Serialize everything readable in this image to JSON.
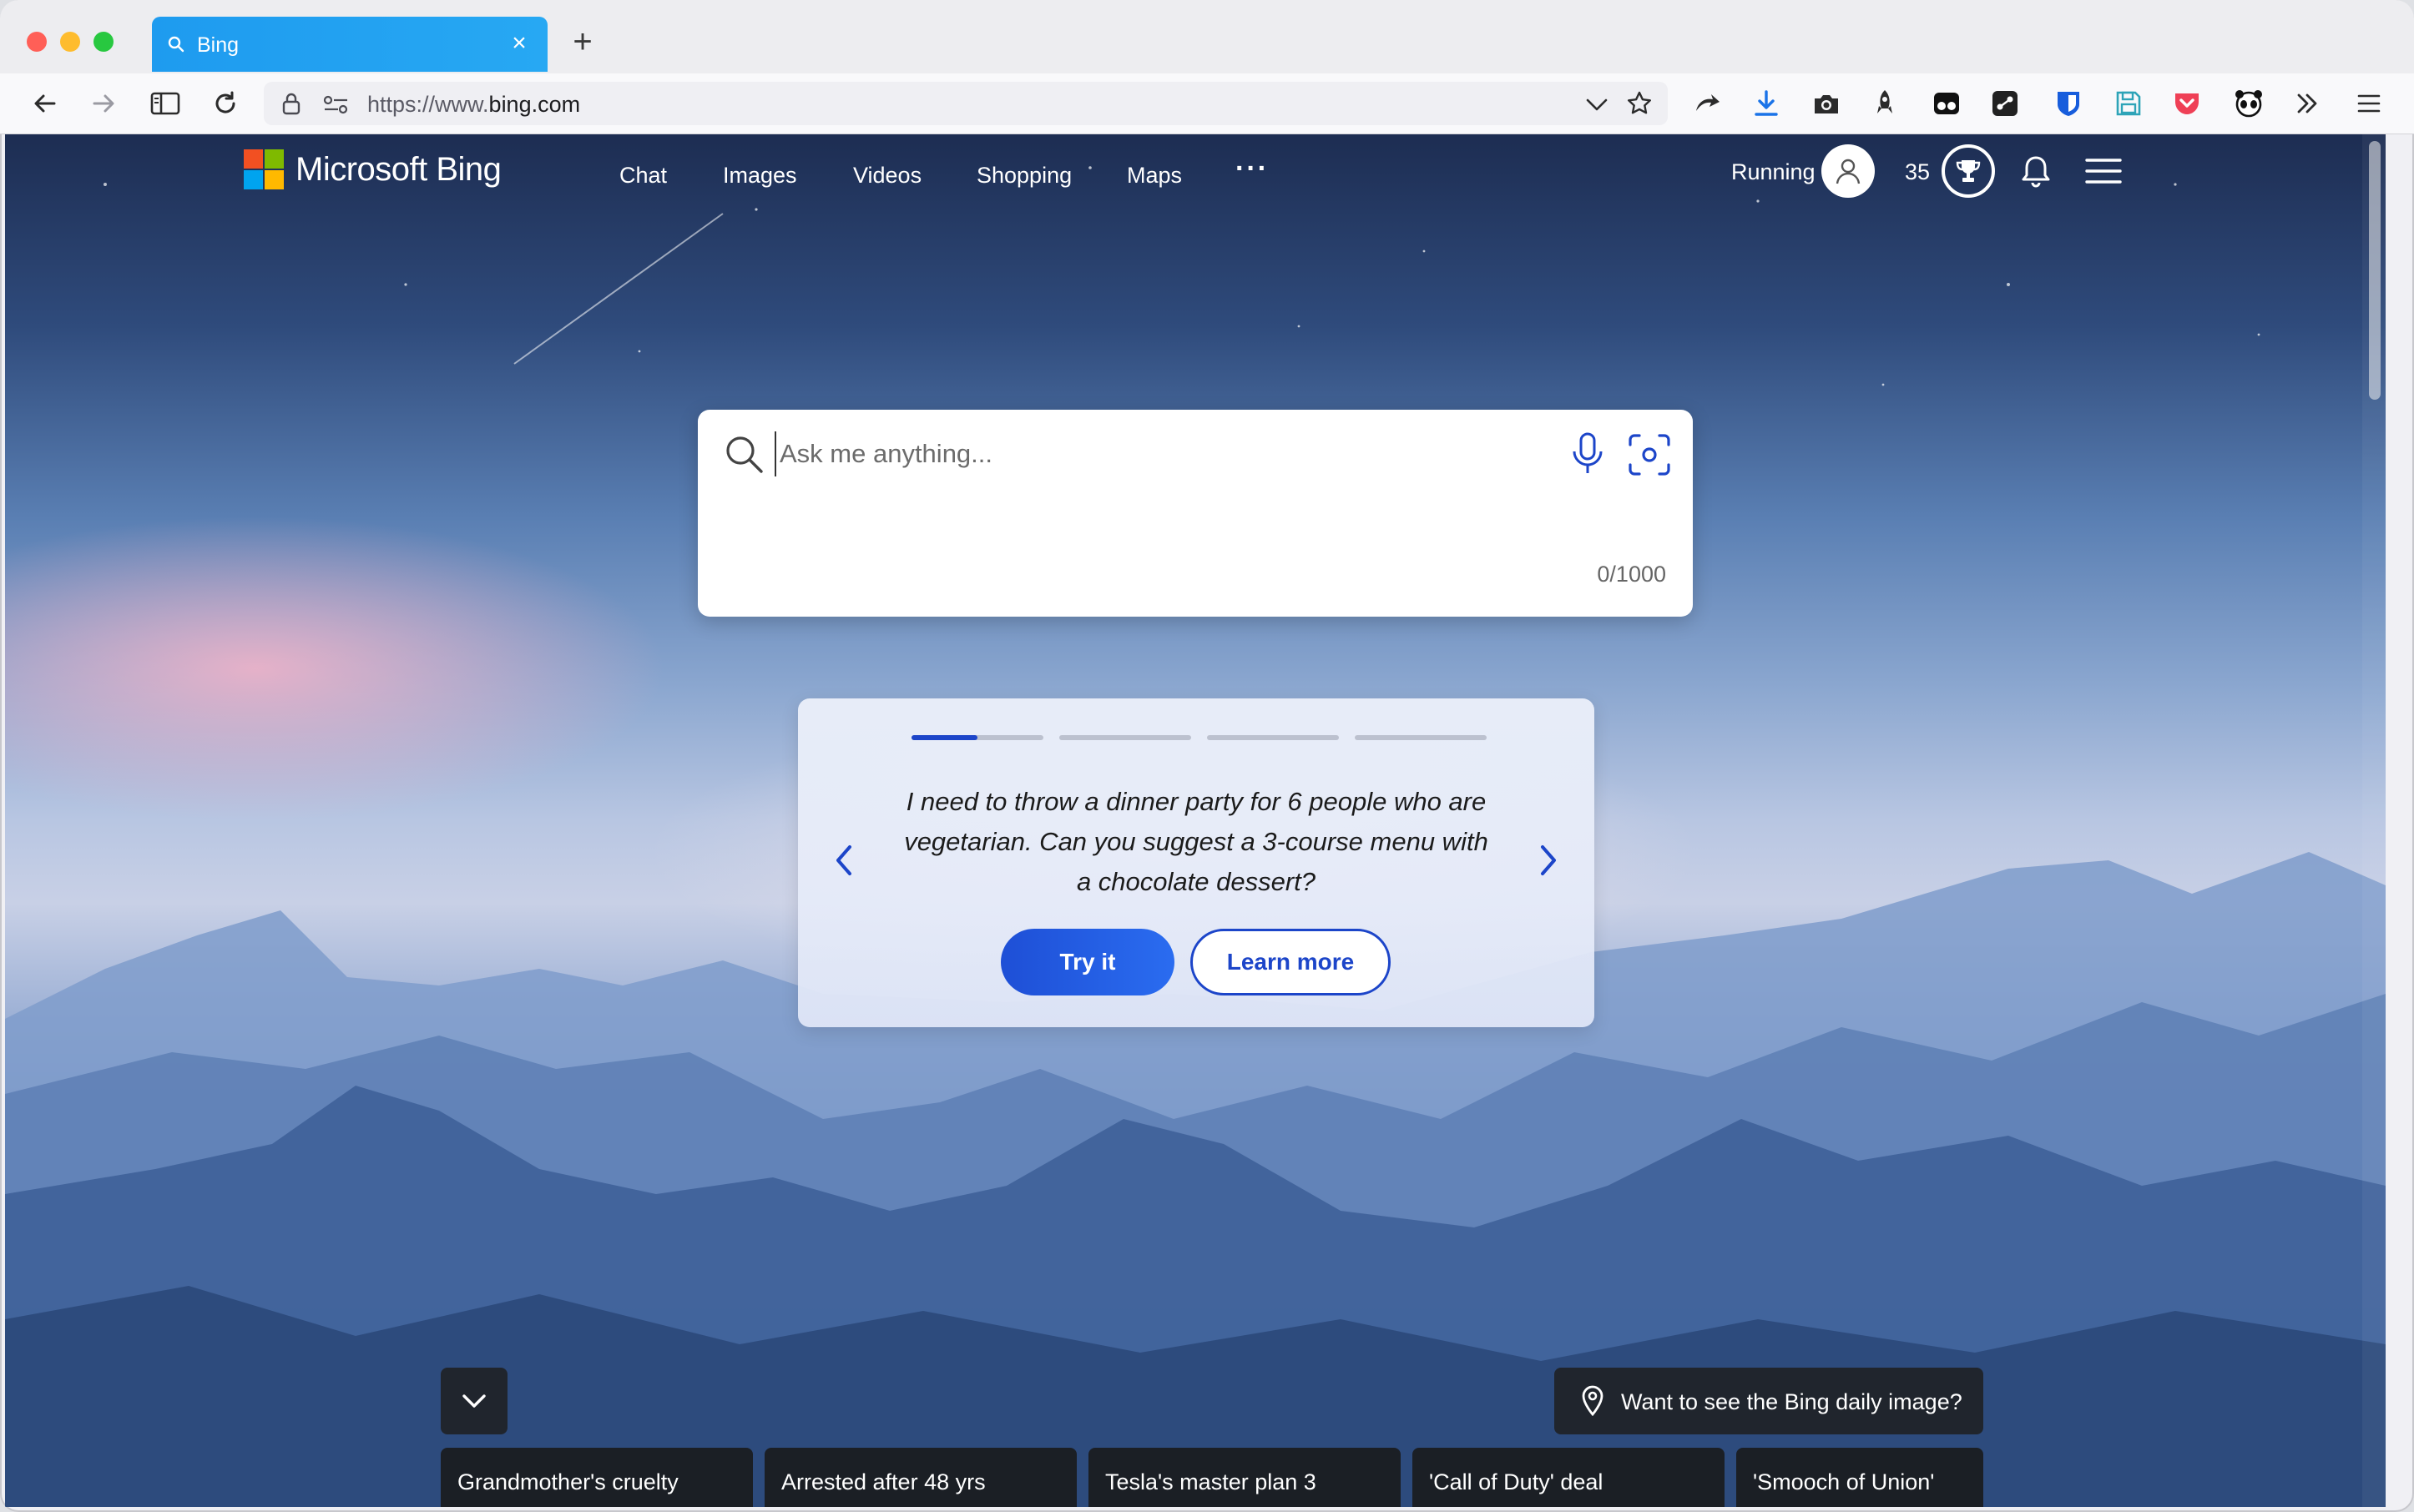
{
  "tab": {
    "title": "Bing",
    "close": "×",
    "new_tab": "+"
  },
  "address_bar": {
    "url_prefix": "https://www.",
    "url_host": "bing.com"
  },
  "header": {
    "logo_text": "Microsoft Bing",
    "nav": [
      "Chat",
      "Images",
      "Videos",
      "Shopping",
      "Maps"
    ],
    "more": "···",
    "profile_name": "Running",
    "points": "35"
  },
  "search": {
    "placeholder": "Ask me anything...",
    "char_count": "0/1000"
  },
  "suggestion": {
    "text": "I need to throw a dinner party for 6 people who are vegetarian. Can you suggest a 3-course menu with a chocolate dessert?",
    "try_label": "Try it",
    "learn_label": "Learn more",
    "active_progress": 0.5
  },
  "daily_image": {
    "label": "Want to see the Bing daily image?"
  },
  "news": [
    "Grandmother's cruelty",
    "Arrested after 48 yrs",
    "Tesla's master plan 3",
    "'Call of Duty' deal",
    "'Smooch of Union'"
  ],
  "colors": {
    "accent": "#1c45c9",
    "tab": "#1aa1f1",
    "ms_red": "#f25022",
    "ms_green": "#7fba00",
    "ms_blue": "#00a4ef",
    "ms_yellow": "#ffb900"
  }
}
